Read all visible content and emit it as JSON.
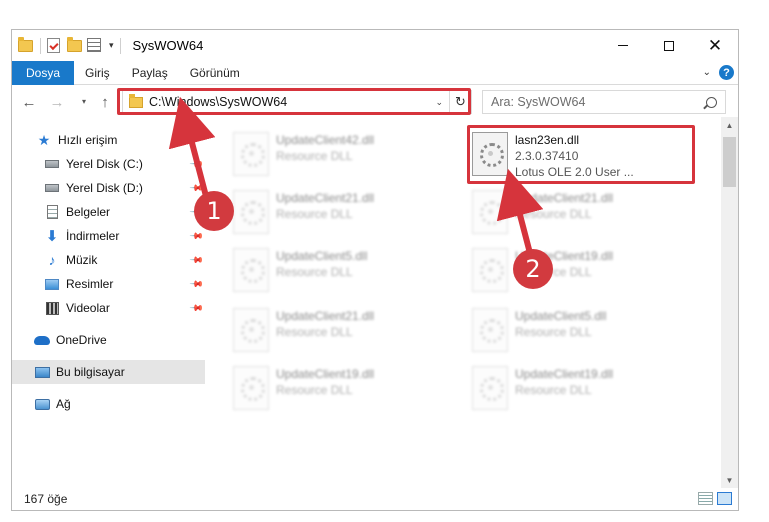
{
  "window": {
    "title": "SysWOW64"
  },
  "ribbon": {
    "tabs": [
      "Dosya",
      "Giriş",
      "Paylaş",
      "Görünüm"
    ],
    "help_label": "?"
  },
  "nav": {
    "back_icon": "arrow-left-icon",
    "forward_icon": "arrow-right-icon",
    "up_icon": "arrow-up-icon",
    "address_path": "C:\\Windows\\SysWOW64",
    "search_placeholder": "Ara: SysWOW64"
  },
  "sidebar": {
    "items": [
      {
        "label": "Hızlı erişim",
        "icon": "star-icon",
        "pinned": false
      },
      {
        "label": "Yerel Disk (C:)",
        "icon": "drive-icon",
        "pinned": true
      },
      {
        "label": "Yerel Disk (D:)",
        "icon": "drive-icon",
        "pinned": true
      },
      {
        "label": "Belgeler",
        "icon": "document-icon",
        "pinned": true
      },
      {
        "label": "İndirmeler",
        "icon": "download-icon",
        "pinned": true
      },
      {
        "label": "Müzik",
        "icon": "music-icon",
        "pinned": true
      },
      {
        "label": "Resimler",
        "icon": "pictures-icon",
        "pinned": true
      },
      {
        "label": "Videolar",
        "icon": "video-icon",
        "pinned": true
      },
      {
        "label": "OneDrive",
        "icon": "cloud-icon",
        "pinned": false
      },
      {
        "label": "Bu bilgisayar",
        "icon": "computer-icon",
        "pinned": false,
        "selected": true
      },
      {
        "label": "Ağ",
        "icon": "network-icon",
        "pinned": false
      }
    ]
  },
  "files": {
    "left": [
      {
        "name": "UpdateClient42.dll",
        "desc": "Resource DLL"
      },
      {
        "name": "UpdateClient21.dll",
        "desc": "Resource DLL"
      },
      {
        "name": "UpdateClient5.dll",
        "desc": "Resource DLL"
      },
      {
        "name": "UpdateClient21.dll",
        "desc": "Resource DLL"
      },
      {
        "name": "UpdateClient19.dll",
        "desc": "Resource DLL"
      }
    ],
    "right": [
      {
        "name": "lasn23en.dll",
        "version": "2.3.0.37410",
        "desc": "Lotus OLE 2.0 User ..."
      },
      {
        "name": "UpdateClient21.dll",
        "desc": "Resource DLL"
      },
      {
        "name": "UpdateClient19.dll",
        "desc": "Resource DLL"
      },
      {
        "name": "UpdateClient5.dll",
        "desc": "Resource DLL"
      },
      {
        "name": "UpdateClient19.dll",
        "desc": "Resource DLL"
      }
    ]
  },
  "status": {
    "item_count": "167 öğe"
  },
  "annotations": {
    "badge_1": "1",
    "badge_2": "2",
    "color": "#d6343c"
  }
}
